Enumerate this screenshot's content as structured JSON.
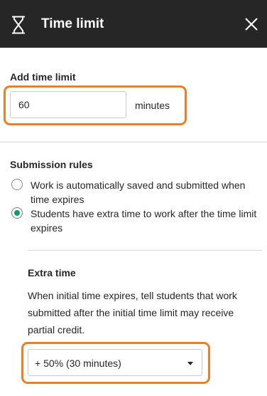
{
  "header": {
    "title": "Time limit",
    "icon": "hourglass-icon",
    "close_icon": "close-icon"
  },
  "time_limit": {
    "label": "Add time limit",
    "value": "60",
    "unit": "minutes"
  },
  "submission_rules": {
    "label": "Submission rules",
    "options": [
      {
        "label": "Work is automatically saved and submitted when time expires",
        "checked": false
      },
      {
        "label": "Students have extra time to work after the time limit expires",
        "checked": true
      }
    ]
  },
  "extra_time": {
    "label": "Extra time",
    "description": "When initial time expires, tell students that work submitted after the initial time limit may receive partial credit.",
    "selected": "+ 50% (30 minutes)"
  },
  "colors": {
    "header_bg": "#262626",
    "highlight": "#ea7f26",
    "radio_selected": "#0d9c6a"
  }
}
